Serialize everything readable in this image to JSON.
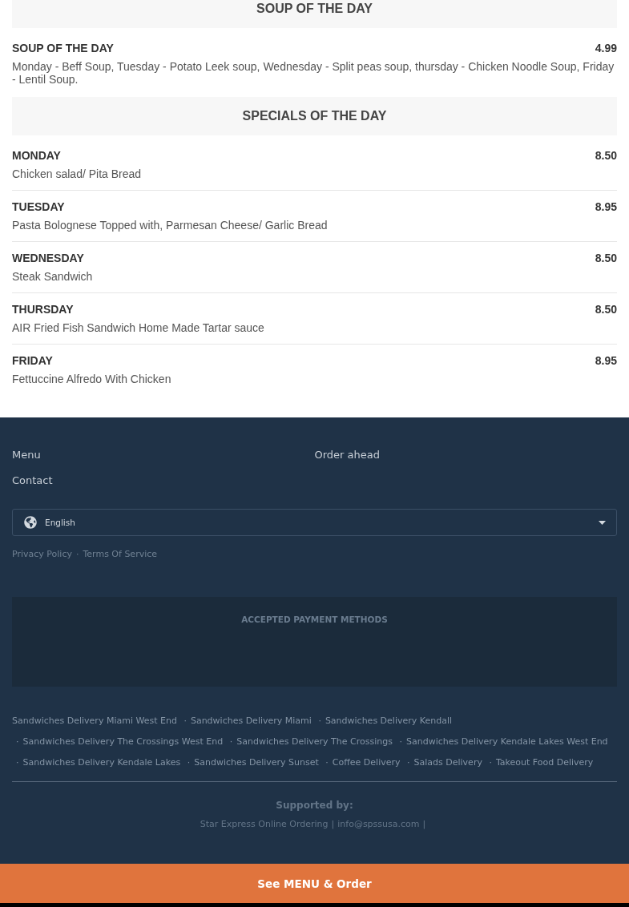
{
  "sections": [
    {
      "title": "SOUP OF THE DAY",
      "items": [
        {
          "name": "SOUP OF THE DAY",
          "price": "4.99",
          "description": "Monday - Beff Soup, Tuesday - Potato Leek soup, Wednesday - Split peas soup, thursday - Chicken Noodle Soup, Friday - Lentil Soup."
        }
      ]
    },
    {
      "title": "SPECIALS OF THE DAY",
      "items": [
        {
          "name": "MONDAY",
          "price": "8.50",
          "description": "Chicken salad/ Pita Bread"
        },
        {
          "name": "TUESDAY",
          "price": "8.95",
          "description": "Pasta Bolognese Topped with, Parmesan Cheese/ Garlic Bread"
        },
        {
          "name": "WEDNESDAY",
          "price": "8.50",
          "description": "Steak Sandwich"
        },
        {
          "name": "THURSDAY",
          "price": "8.50",
          "description": "AIR Fried Fish Sandwich Home Made Tartar sauce"
        },
        {
          "name": "FRIDAY",
          "price": "8.95",
          "description": "Fettuccine Alfredo With Chicken"
        }
      ]
    }
  ],
  "footer": {
    "nav_links": [
      "Menu",
      "Order ahead",
      "Contact"
    ],
    "language_select": {
      "value": "English"
    },
    "legal_links": [
      "Privacy Policy",
      "Terms Of Service"
    ],
    "link_separator": "·",
    "payment_methods": {
      "title": "ACCEPTED PAYMENT METHODS"
    },
    "location_links": [
      "Sandwiches Delivery Miami West End",
      "Sandwiches Delivery Miami",
      "Sandwiches Delivery Kendall",
      "Sandwiches Delivery The Crossings West End",
      "Sandwiches Delivery The Crossings",
      "Sandwiches Delivery Kendale Lakes West End",
      "Sandwiches Delivery Kendale Lakes",
      "Sandwiches Delivery Sunset",
      "Coffee Delivery",
      "Salads Delivery",
      "Takeout Food Delivery"
    ],
    "supported_by": {
      "title": "Supported by:",
      "links": [
        "Star Express Online Ordering",
        "info@spssusa.com"
      ],
      "separator": "|"
    }
  },
  "order_button": {
    "label": "See MENU & Order"
  }
}
